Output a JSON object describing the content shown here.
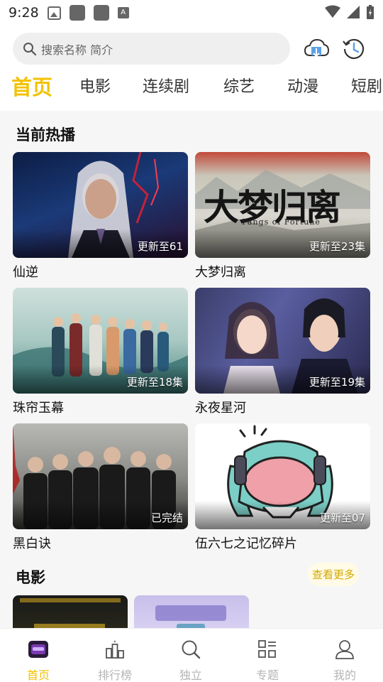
{
  "status_bar": {
    "time": "9:28"
  },
  "search": {
    "placeholder": "搜索名称 简介"
  },
  "tabs": [
    {
      "label": "首页",
      "active": true
    },
    {
      "label": "电影"
    },
    {
      "label": "连续剧"
    },
    {
      "label": "综艺"
    },
    {
      "label": "动漫"
    },
    {
      "label": "短剧"
    }
  ],
  "sections": {
    "hot": {
      "title": "当前热播",
      "items": [
        {
          "name": "仙逆",
          "badge": "更新至61"
        },
        {
          "name": "大梦归离",
          "badge": "更新至23集",
          "poster_title": "大梦归离",
          "poster_subtitle": "Fangs of Fortune"
        },
        {
          "name": "珠帘玉幕",
          "badge": "更新至18集"
        },
        {
          "name": "永夜星河",
          "badge": "更新至19集"
        },
        {
          "name": "黑白诀",
          "badge": "已完结"
        },
        {
          "name": "伍六七之记忆碎片",
          "badge": "更新至07"
        }
      ]
    },
    "movies": {
      "title": "电影",
      "more_label": "查看更多"
    }
  },
  "bottom_nav": [
    {
      "label": "首页",
      "active": true
    },
    {
      "label": "排行榜"
    },
    {
      "label": "独立"
    },
    {
      "label": "专题"
    },
    {
      "label": "我的"
    }
  ],
  "colors": {
    "accent": "#f2c200",
    "muted": "#b5b5b5",
    "content_bg": "#f6f6f6"
  }
}
